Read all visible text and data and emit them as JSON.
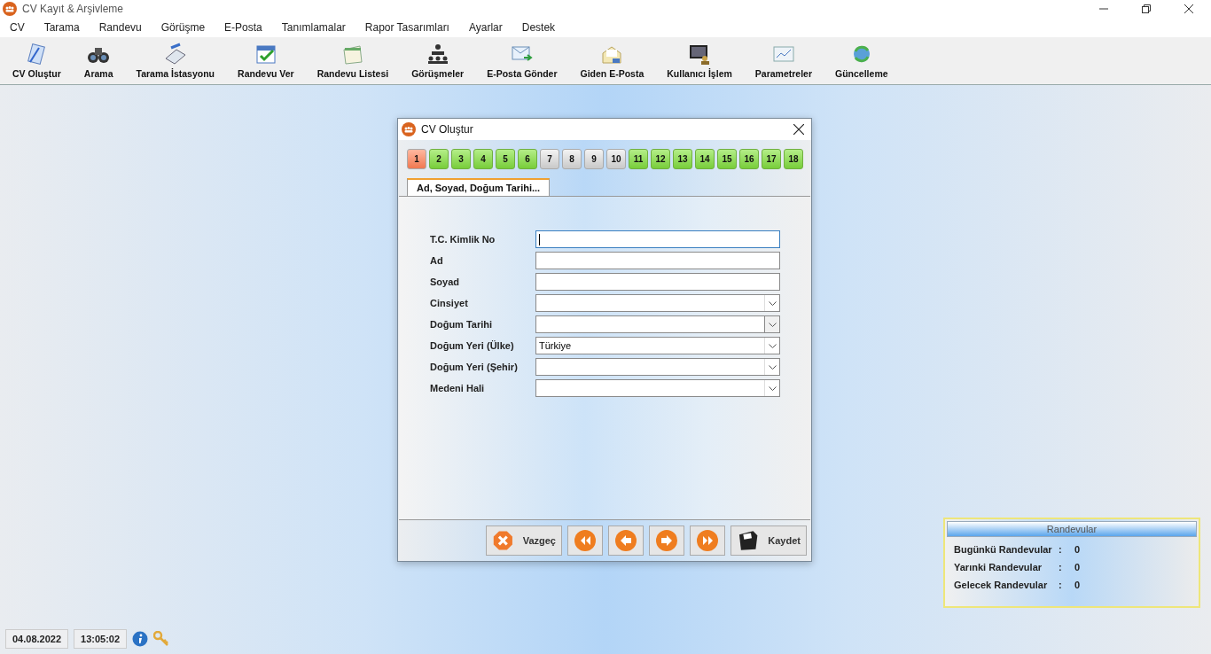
{
  "window": {
    "title": "CV Kayıt & Arşivleme"
  },
  "menu": [
    "CV",
    "Tarama",
    "Randevu",
    "Görüşme",
    "E-Posta",
    "Tanımlamalar",
    "Rapor Tasarımları",
    "Ayarlar",
    "Destek"
  ],
  "toolbar": [
    {
      "label": "CV Oluştur",
      "kind": "doc"
    },
    {
      "label": "Arama",
      "kind": "binoculars"
    },
    {
      "label": "Tarama İstasyonu",
      "kind": "scanner"
    },
    {
      "label": "Randevu Ver",
      "kind": "check"
    },
    {
      "label": "Randevu Listesi",
      "kind": "calendar"
    },
    {
      "label": "Görüşmeler",
      "kind": "meeting"
    },
    {
      "label": "E-Posta Gönder",
      "kind": "mailsend"
    },
    {
      "label": "Giden E-Posta",
      "kind": "mailout"
    },
    {
      "label": "Kullanıcı İşlem",
      "kind": "user"
    },
    {
      "label": "Parametreler",
      "kind": "params"
    },
    {
      "label": "Güncelleme",
      "kind": "update"
    }
  ],
  "dialog": {
    "title": "CV Oluştur",
    "steps": [
      {
        "label": "1",
        "selected": true,
        "complete": false
      },
      {
        "label": "2",
        "selected": false,
        "complete": true
      },
      {
        "label": "3",
        "selected": false,
        "complete": true
      },
      {
        "label": "4",
        "selected": false,
        "complete": true
      },
      {
        "label": "5",
        "selected": false,
        "complete": true
      },
      {
        "label": "6",
        "selected": false,
        "complete": true
      },
      {
        "label": "7",
        "selected": false,
        "complete": false
      },
      {
        "label": "8",
        "selected": false,
        "complete": false
      },
      {
        "label": "9",
        "selected": false,
        "complete": false
      },
      {
        "label": "10",
        "selected": false,
        "complete": false
      },
      {
        "label": "11",
        "selected": false,
        "complete": true
      },
      {
        "label": "12",
        "selected": false,
        "complete": true
      },
      {
        "label": "13",
        "selected": false,
        "complete": true
      },
      {
        "label": "14",
        "selected": false,
        "complete": true
      },
      {
        "label": "15",
        "selected": false,
        "complete": true
      },
      {
        "label": "16",
        "selected": false,
        "complete": true
      },
      {
        "label": "17",
        "selected": false,
        "complete": true
      },
      {
        "label": "18",
        "selected": false,
        "complete": true
      }
    ],
    "tab": {
      "label": "Ad, Soyad, Doğum Tarihi...",
      "selected": true
    },
    "fields": [
      {
        "label": "T.C. Kimlik No",
        "kind": "text",
        "focused": true
      },
      {
        "label": "Ad",
        "kind": "text",
        "focused": false
      },
      {
        "label": "Soyad",
        "kind": "text",
        "focused": false
      },
      {
        "label": "Cinsiyet",
        "kind": "combo",
        "focused": false
      },
      {
        "label": "Doğum Tarihi",
        "kind": "date",
        "focused": false
      },
      {
        "label": "Doğum Yeri (Ülke)",
        "kind": "combo",
        "focused": false,
        "value": "Türkiye"
      },
      {
        "label": "Doğum Yeri (Şehir)",
        "kind": "combo",
        "focused": false
      },
      {
        "label": "Medeni Hali",
        "kind": "combo",
        "focused": false
      }
    ],
    "buttons": {
      "cancel": "Vazgeç",
      "save": "Kaydet"
    }
  },
  "appointments": {
    "title": "Randevular",
    "rows": [
      {
        "label": "Bugünkü Randevular",
        "separator": ":",
        "value": "0"
      },
      {
        "label": "Yarınki Randevular",
        "separator": ":",
        "value": "0"
      },
      {
        "label": "Gelecek Randevular",
        "separator": ":",
        "value": "0"
      }
    ]
  },
  "status_bar": {
    "date": "04.08.2022",
    "time": "13:05:02"
  }
}
